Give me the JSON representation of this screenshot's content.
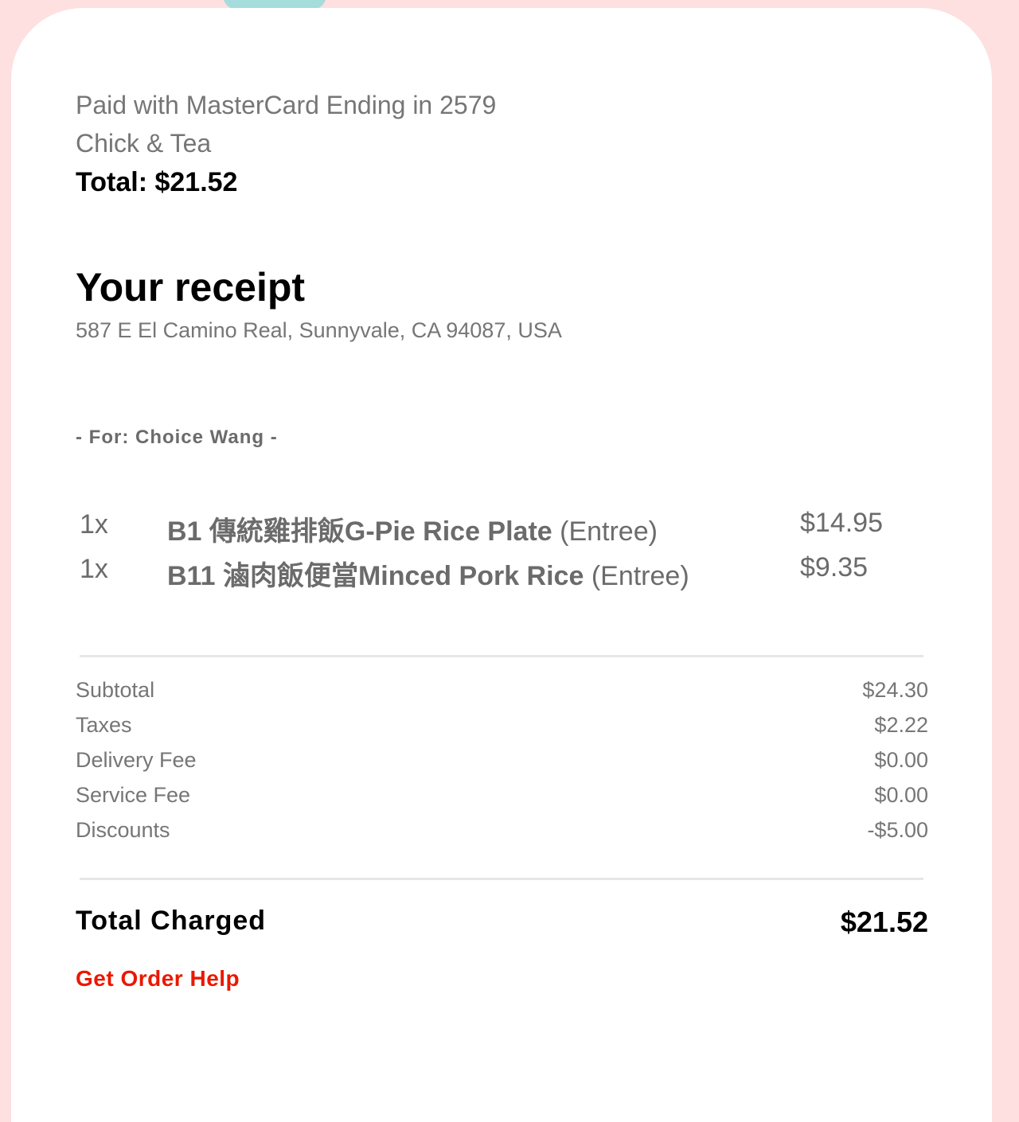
{
  "payment": {
    "paid_with": "Paid with MasterCard Ending in 2579",
    "store_name": "Chick & Tea",
    "total": "Total: $21.52"
  },
  "receipt": {
    "title": "Your receipt",
    "address": "587 E El Camino Real, Sunnyvale, CA 94087, USA",
    "for_line": "- For: Choice Wang -"
  },
  "items": [
    {
      "qty": "1x",
      "name": "B1 傳統雞排飯G-Pie Rice Plate",
      "category": " (Entree)",
      "price": "$14.95"
    },
    {
      "qty": "1x",
      "name": "B11 滷肉飯便當Minced Pork Rice",
      "category": " (Entree)",
      "price": "$9.35"
    }
  ],
  "fees": [
    {
      "label": "Subtotal",
      "value": "$24.30"
    },
    {
      "label": "Taxes",
      "value": "$2.22"
    },
    {
      "label": "Delivery Fee",
      "value": "$0.00"
    },
    {
      "label": "Service Fee",
      "value": "$0.00"
    },
    {
      "label": "Discounts",
      "value": "-$5.00"
    }
  ],
  "summary": {
    "total_charged_label": "Total Charged",
    "total_charged_value": "$21.52",
    "help_link": "Get Order Help"
  },
  "colors": {
    "background": "#fde0df",
    "accent_link": "#eb1700",
    "muted_text": "#767676"
  }
}
